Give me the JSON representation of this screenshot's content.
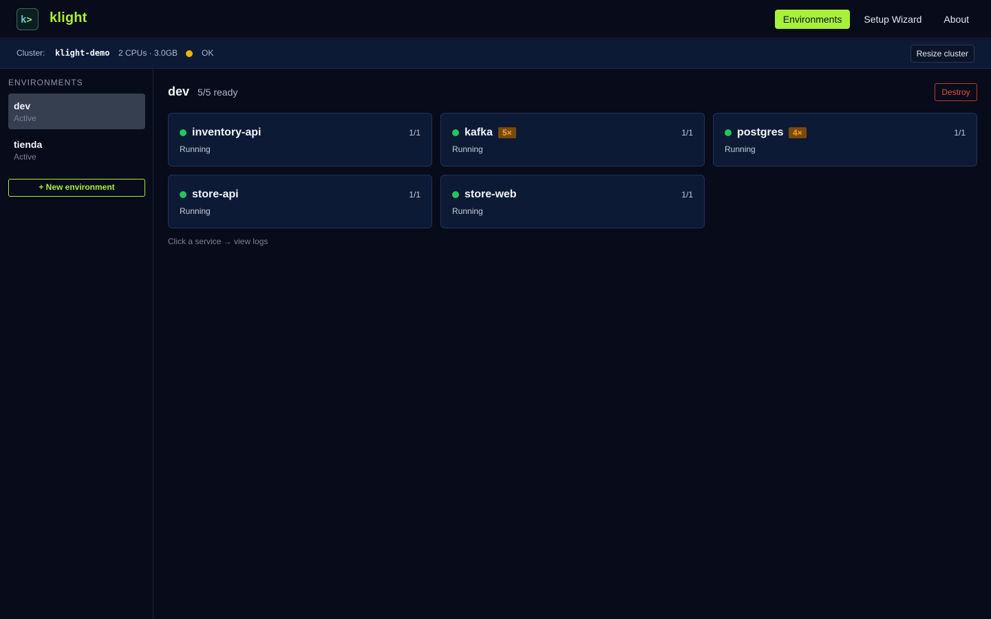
{
  "app": {
    "name": "klight",
    "logo_glyph": "k>"
  },
  "nav": [
    {
      "label": "Environments",
      "active": true
    },
    {
      "label": "Setup Wizard",
      "active": false
    },
    {
      "label": "About",
      "active": false
    }
  ],
  "cluster": {
    "label": "Cluster:",
    "name": "klight-demo",
    "spec": "2 CPUs · 3.0GB",
    "status": "OK",
    "status_color": "#eab308",
    "resize_label": "Resize cluster"
  },
  "sidebar": {
    "heading": "ENVIRONMENTS",
    "items": [
      {
        "name": "dev",
        "status": "Active",
        "selected": true
      },
      {
        "name": "tienda",
        "status": "Active",
        "selected": false
      }
    ],
    "new_label": "+ New environment"
  },
  "main": {
    "title": "dev",
    "ready": "5/5 ready",
    "destroy_label": "Destroy",
    "hint": "Click a service → view logs",
    "services": [
      {
        "name": "inventory-api",
        "status": "Running",
        "replicas": "1/1",
        "badge": ""
      },
      {
        "name": "kafka",
        "status": "Running",
        "replicas": "1/1",
        "badge": "5×"
      },
      {
        "name": "postgres",
        "status": "Running",
        "replicas": "1/1",
        "badge": "4×"
      },
      {
        "name": "store-api",
        "status": "Running",
        "replicas": "1/1",
        "badge": ""
      },
      {
        "name": "store-web",
        "status": "Running",
        "replicas": "1/1",
        "badge": ""
      }
    ]
  },
  "colors": {
    "accent": "#a8f03a",
    "running": "#22c55e",
    "danger": "#e74c3c",
    "badge_bg": "#7a4a0c",
    "badge_text": "#f5a623"
  }
}
